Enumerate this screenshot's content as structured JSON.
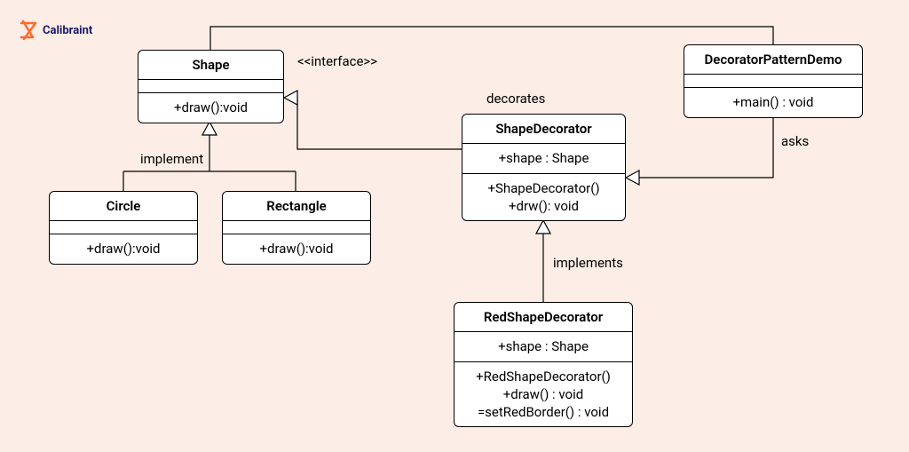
{
  "brand": {
    "name": "Calibraint"
  },
  "stereotypes": {
    "interface": "<<interface>>"
  },
  "labels": {
    "implement": "implement",
    "implements": "implements",
    "decorates": "decorates",
    "asks": "asks"
  },
  "classes": {
    "shape": {
      "name": "Shape",
      "ops": "+draw():void"
    },
    "circle": {
      "name": "Circle",
      "ops": "+draw():void"
    },
    "rectangle": {
      "name": "Rectangle",
      "ops": "+draw():void"
    },
    "shapeDecorator": {
      "name": "ShapeDecorator",
      "attrs": "+shape : Shape",
      "ops1": "+ShapeDecorator()",
      "ops2": "+drw(): void"
    },
    "redShapeDecorator": {
      "name": "RedShapeDecorator",
      "attrs": "+shape : Shape",
      "ops1": "+RedShapeDecorator()",
      "ops2": "+draw() : void",
      "ops3": "=setRedBorder() : void"
    },
    "demo": {
      "name": "DecoratorPatternDemo",
      "ops": "+main() : void"
    }
  }
}
